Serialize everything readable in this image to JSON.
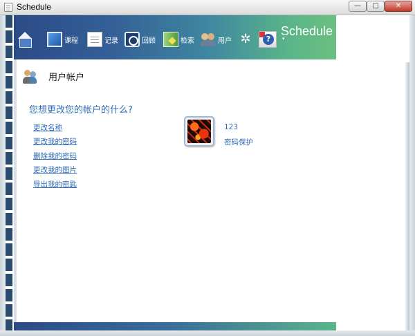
{
  "window": {
    "title": "Schedule",
    "min_label": "—",
    "max_label": "□",
    "close_label": "✕"
  },
  "toolbar": {
    "items": [
      {
        "label": "",
        "icon": "home-icon"
      },
      {
        "label": "课程",
        "icon": "course-icon"
      },
      {
        "label": "记录",
        "icon": "record-icon"
      },
      {
        "label": "回顾",
        "icon": "review-icon"
      },
      {
        "label": "检索",
        "icon": "search-icon"
      },
      {
        "label": "用户",
        "icon": "users-icon"
      },
      {
        "label": "",
        "icon": "gear-icon"
      },
      {
        "label": "",
        "icon": "help-icon"
      }
    ],
    "gear_glyph": "✲",
    "brand": "Schedule",
    "brand_caret": "▾"
  },
  "main": {
    "section_title": "用户帐户",
    "question": "您想更改您的帐户的什么?",
    "links": [
      "更改名称",
      "更改我的密码",
      "删除我的密码",
      "更改我的图片",
      "导出我的密匙"
    ],
    "user": {
      "name": "123",
      "status": "密码保护"
    }
  },
  "colors": {
    "link": "#2f6cb5",
    "toolbar_start": "#2b4a86",
    "toolbar_end": "#6cc07f"
  }
}
